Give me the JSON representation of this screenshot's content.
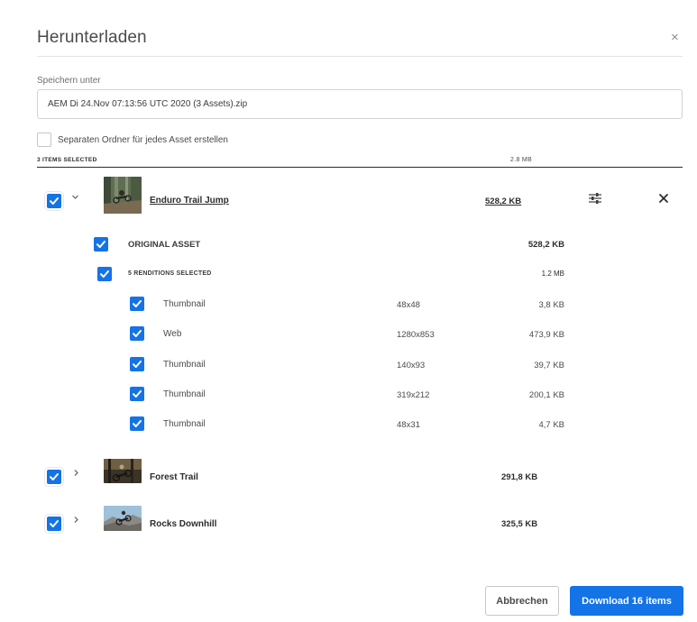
{
  "dialog": {
    "title": "Herunterladen",
    "close_glyph": "×"
  },
  "save_as": {
    "label": "Speichern unter",
    "value": "AEM Di 24.Nov 07:13:56 UTC 2020 (3 Assets).zip"
  },
  "separate_folder": {
    "label": "Separaten Ordner für jedes Asset erstellen",
    "checked": false
  },
  "summary": {
    "items_selected": "3 ITEMS SELECTED",
    "total_size": "2.8 MB"
  },
  "assets": [
    {
      "name": "Enduro Trail Jump",
      "size": "528,2 KB",
      "expanded": true,
      "checked": true,
      "original": {
        "label": "ORIGINAL ASSET",
        "size": "528,2 KB",
        "checked": true
      },
      "renditions_summary": {
        "label": "5 RENDITIONS SELECTED",
        "size": "1.2 MB",
        "checked": true
      },
      "renditions": [
        {
          "name": "Thumbnail",
          "dims": "48x48",
          "size": "3,8 KB",
          "checked": true
        },
        {
          "name": "Web",
          "dims": "1280x853",
          "size": "473,9 KB",
          "checked": true
        },
        {
          "name": "Thumbnail",
          "dims": "140x93",
          "size": "39,7 KB",
          "checked": true
        },
        {
          "name": "Thumbnail",
          "dims": "319x212",
          "size": "200,1 KB",
          "checked": true
        },
        {
          "name": "Thumbnail",
          "dims": "48x31",
          "size": "4,7 KB",
          "checked": true
        }
      ]
    },
    {
      "name": "Forest Trail",
      "size": "291,8 KB",
      "expanded": false,
      "checked": true
    },
    {
      "name": "Rocks Downhill",
      "size": "325,5 KB",
      "expanded": false,
      "checked": true
    }
  ],
  "icons": {
    "expand": "chevron-down-icon",
    "collapse": "chevron-right-icon",
    "settings": "sliders-icon",
    "remove": "close-icon"
  },
  "buttons": {
    "cancel": "Abbrechen",
    "download": "Download 16 items"
  },
  "colors": {
    "accent": "#1473e6",
    "text": "#2c2c2c"
  }
}
